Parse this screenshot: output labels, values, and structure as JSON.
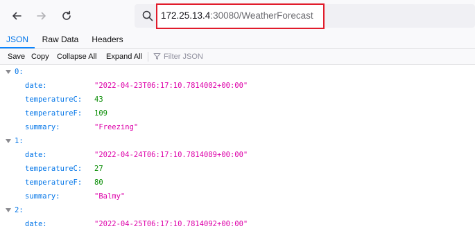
{
  "address_bar": {
    "url_host": "172.25.13.4",
    "url_rest": ":30080/WeatherForecast"
  },
  "tabs": [
    {
      "label": "JSON",
      "active": true
    },
    {
      "label": "Raw Data",
      "active": false
    },
    {
      "label": "Headers",
      "active": false
    }
  ],
  "actions": {
    "save": "Save",
    "copy": "Copy",
    "collapse_all": "Collapse All",
    "expand_all": "Expand All",
    "filter_placeholder": "Filter JSON"
  },
  "tree": {
    "items": [
      {
        "index": "0:",
        "fields": [
          {
            "key": "date:",
            "value": "\"2022-04-23T06:17:10.7814002+00:00\"",
            "type": "string"
          },
          {
            "key": "temperatureC:",
            "value": "43",
            "type": "number"
          },
          {
            "key": "temperatureF:",
            "value": "109",
            "type": "number"
          },
          {
            "key": "summary:",
            "value": "\"Freezing\"",
            "type": "string"
          }
        ]
      },
      {
        "index": "1:",
        "fields": [
          {
            "key": "date:",
            "value": "\"2022-04-24T06:17:10.7814089+00:00\"",
            "type": "string"
          },
          {
            "key": "temperatureC:",
            "value": "27",
            "type": "number"
          },
          {
            "key": "temperatureF:",
            "value": "80",
            "type": "number"
          },
          {
            "key": "summary:",
            "value": "\"Balmy\"",
            "type": "string"
          }
        ]
      },
      {
        "index": "2:",
        "fields": [
          {
            "key": "date:",
            "value": "\"2022-04-25T06:17:10.7814092+00:00\"",
            "type": "string"
          }
        ]
      }
    ]
  },
  "colors": {
    "key": "#0074e8",
    "string": "#dd00a9",
    "number": "#058b00",
    "highlight_border": "#e11b2b"
  }
}
